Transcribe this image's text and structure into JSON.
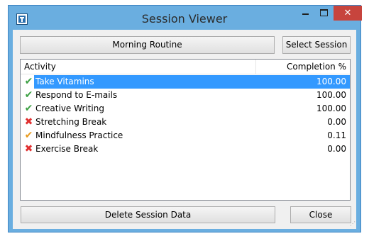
{
  "window": {
    "title": "Session Viewer",
    "close_glyph": "✕"
  },
  "session": {
    "name": "Morning Routine",
    "select_label": "Select Session"
  },
  "table": {
    "columns": [
      "Activity",
      "Completion %"
    ],
    "selected_index": 0,
    "rows": [
      {
        "activity": "Take Vitamins",
        "completion": "100.00",
        "status_icon": "check-icon",
        "glyph": "✔"
      },
      {
        "activity": "Respond to E-mails",
        "completion": "100.00",
        "status_icon": "check-icon",
        "glyph": "✔"
      },
      {
        "activity": "Creative Writing",
        "completion": "100.00",
        "status_icon": "check-icon",
        "glyph": "✔"
      },
      {
        "activity": "Stretching Break",
        "completion": "0.00",
        "status_icon": "cross-icon",
        "glyph": "✖"
      },
      {
        "activity": "Mindfulness Practice",
        "completion": "0.11",
        "status_icon": "partial-check-icon",
        "glyph": "✔"
      },
      {
        "activity": "Exercise Break",
        "completion": "0.00",
        "status_icon": "cross-icon",
        "glyph": "✖"
      }
    ]
  },
  "footer": {
    "delete_label": "Delete Session Data",
    "close_label": "Close"
  },
  "colors": {
    "frame": "#6aaee0",
    "selection": "#3399ff",
    "close_button": "#c7443d",
    "ok": "#3ea145",
    "partial": "#e89a1d",
    "fail": "#e02f2f"
  }
}
